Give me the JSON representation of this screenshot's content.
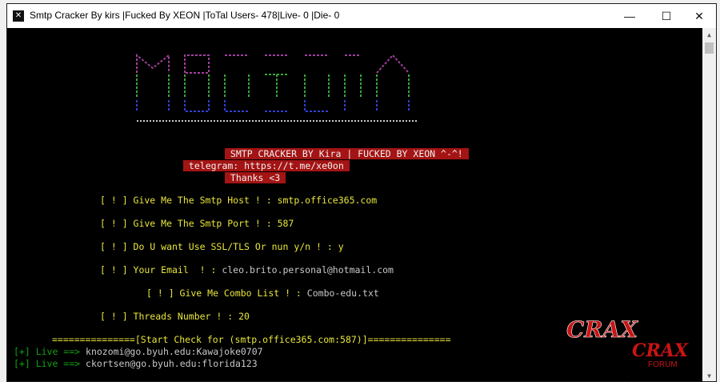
{
  "window": {
    "title": "Smtp Cracker By kirs |Fucked By XEON |ToTal Users- 478|Live- 0 |Die- 0",
    "app_icon": "terminal-app-icon",
    "controls": {
      "minimize": "—",
      "maximize": "☐",
      "close": "✕"
    }
  },
  "banner": {
    "line1": " SMTP CRACKER BY Kira | FUCKED BY XEON ^-^! ",
    "line2": " telegram: https://t.me/xe0on ",
    "line3": " Thanks <3 "
  },
  "prompts": [
    {
      "label": "[ ! ] Give Me The Smtp Host ! : ",
      "value": "smtp.office365.com"
    },
    {
      "label": "[ ! ] Give Me The Smtp Port ! : ",
      "value": "587"
    },
    {
      "label": "[ ! ] Do U want Use SSL/TLS Or nun y/n ! : ",
      "value": "y"
    },
    {
      "label": "[ ! ] Your Email  ! : ",
      "value": "cleo.brito.personal@hotmail.com"
    },
    {
      "label": "[ ! ] Give Me Combo List ! : ",
      "value": "Combo-edu.txt"
    },
    {
      "label": "[ ! ] Threads Number ! : ",
      "value": "20"
    }
  ],
  "start_check": "===============[Start Check for (smtp.office365.com:587)]===============",
  "results": [
    {
      "tag": "[+] Live ==> ",
      "credential": "knozomi@go.byuh.edu:Kawajoke0707"
    },
    {
      "tag": "[+] Live ==> ",
      "credential": "ckortsen@go.byuh.edu:florida123"
    }
  ],
  "watermark": {
    "brand": "CRAX",
    "sub": "FORUM"
  },
  "colors": {
    "prompt": "#e8e63a",
    "live": "#12a012",
    "banner_bg": "#a41414",
    "console_bg": "#000000",
    "watermark": "#c81414"
  }
}
